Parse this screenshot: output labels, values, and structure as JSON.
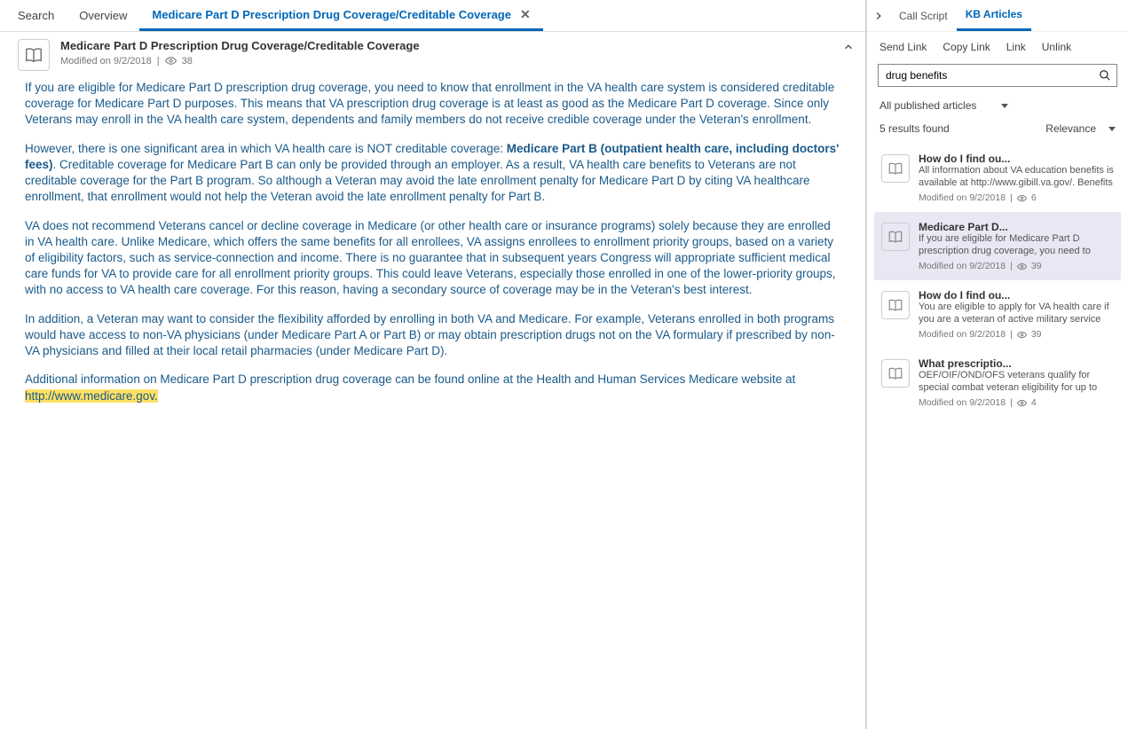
{
  "tabs": [
    {
      "label": "Search"
    },
    {
      "label": "Overview"
    },
    {
      "label": "Medicare Part D Prescription Drug Coverage/Creditable Coverage",
      "active": true,
      "closable": true
    }
  ],
  "article": {
    "title": "Medicare Part D Prescription Drug Coverage/Creditable Coverage",
    "modified": "Modified on 9/2/2018",
    "views": "38",
    "p1": "If you are eligible for Medicare Part D prescription drug coverage, you need to know that enrollment in the VA health care system is considered creditable coverage for Medicare Part D purposes. This means that VA prescription drug coverage is at least as good as the Medicare Part D coverage. Since only Veterans may enroll in the VA health care system, dependents and family members do not receive credible coverage under the Veteran's enrollment.",
    "p2a": "However, there is one significant area in which VA health care is NOT creditable coverage: ",
    "p2b": "Medicare Part B (outpatient health care, including doctors' fees)",
    "p2c": ". Creditable coverage for Medicare Part B can only be provided through an employer. As a result, VA health care benefits to Veterans are not creditable coverage for the Part B program. So although a Veteran may avoid the late enrollment penalty for Medicare Part D by citing VA healthcare enrollment, that enrollment would not help the Veteran avoid the late enrollment penalty for Part B.",
    "p3": "VA does not recommend Veterans cancel or decline coverage in Medicare (or other health care or insurance programs) solely because they are enrolled in VA health care. Unlike Medicare, which offers the same benefits for all enrollees, VA assigns enrollees to enrollment priority groups, based on a variety of eligibility factors, such as service-connection and income. There is no guarantee that in subsequent years Congress will appropriate sufficient medical care funds for VA to provide care for all enrollment priority groups. This could leave Veterans, especially those enrolled in one of the lower-priority groups, with no access to VA health care coverage. For this reason, having a secondary source of coverage may be in the Veteran's best interest.",
    "p4": "In addition, a Veteran may want to consider the flexibility afforded by enrolling in both VA and Medicare. For example, Veterans enrolled in both programs would have access to non-VA physicians (under Medicare Part A or Part B) or may obtain prescription drugs not on the VA formulary if prescribed by non-VA physicians and filled at their local retail pharmacies (under Medicare Part D).",
    "p5a": "Additional information on Medicare Part D prescription drug coverage can be found online at the Health and Human Services Medicare website at ",
    "p5b": "http://www.medicare.gov.  "
  },
  "side": {
    "tabs": {
      "call": "Call Script",
      "kb": "KB Articles"
    },
    "actions": {
      "send": "Send Link",
      "copy": "Copy Link",
      "link": "Link",
      "unlink": "Unlink"
    },
    "search_value": "drug benefits",
    "filter": "All published articles",
    "results_text": "5 results found",
    "sort": "Relevance",
    "results": [
      {
        "title": "How do I find ou...",
        "snippet": "All information about VA education benefits is available at http://www.gibill.va.gov/.   Benefits and",
        "modified": "Modified on 9/2/2018",
        "views": "6"
      },
      {
        "title": "Medicare Part D...",
        "snippet": "If you are eligible for Medicare Part D prescription drug coverage, you need to know that enrollment in",
        "modified": "Modified on 9/2/2018",
        "views": "39",
        "selected": true
      },
      {
        "title": "How do I find ou...",
        "snippet": "You are eligible to apply for VA health care if you are a veteran of active military service and were",
        "modified": "Modified on 9/2/2018",
        "views": "39"
      },
      {
        "title": "What prescriptio...",
        "snippet": "OEF/OIF/OND/OFS veterans qualify for special combat veteran eligibility for up to five years after",
        "modified": "Modified on 9/2/2018",
        "views": "4"
      }
    ]
  }
}
